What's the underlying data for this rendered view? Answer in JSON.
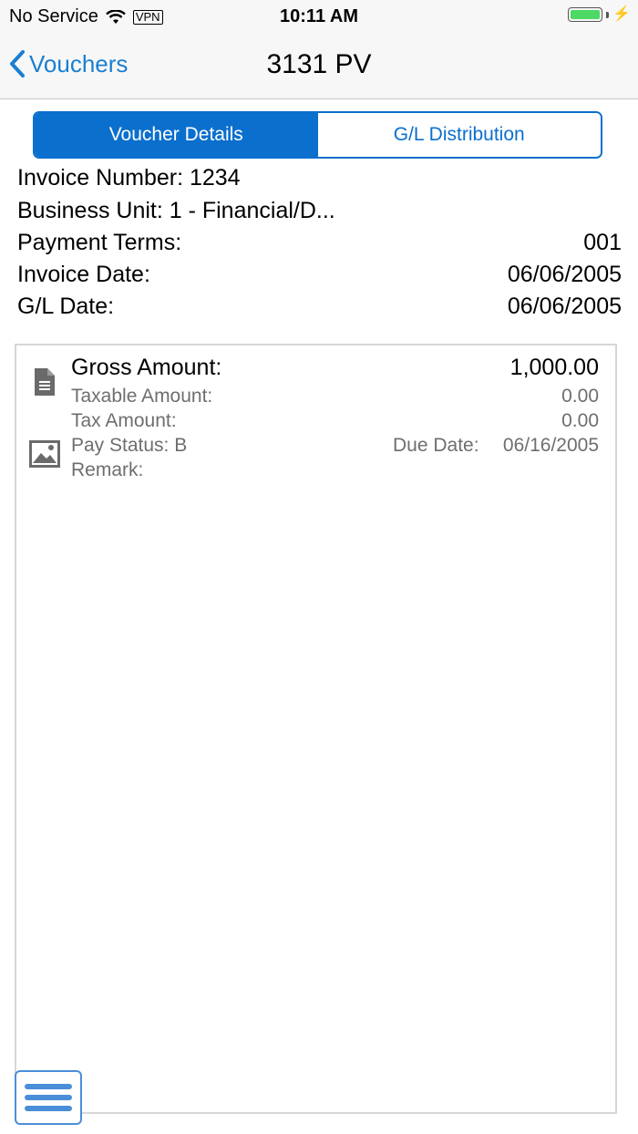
{
  "status_bar": {
    "carrier": "No Service",
    "vpn": "VPN",
    "time": "10:11 AM",
    "battery_level": 1.0
  },
  "nav": {
    "back_label": "Vouchers",
    "title": "3131 PV"
  },
  "tabs": [
    {
      "label": "Voucher Details",
      "active": true
    },
    {
      "label": "G/L Distribution",
      "active": false
    }
  ],
  "header_fields": {
    "invoice_number": "Invoice Number: 1234",
    "business_unit": "Business Unit: 1 - Financial/D...",
    "payment_terms_label": "Payment Terms:",
    "payment_terms_value": "001",
    "invoice_date_label": "Invoice Date:",
    "invoice_date_value": "06/06/2005",
    "gl_date_label": "G/L Date:",
    "gl_date_value": "06/06/2005"
  },
  "detail_card": {
    "gross_amount_label": "Gross Amount:",
    "gross_amount_value": "1,000.00",
    "taxable_amount_label": "Taxable Amount:",
    "taxable_amount_value": "0.00",
    "tax_amount_label": "Tax Amount:",
    "tax_amount_value": "0.00",
    "pay_status": "Pay Status: B",
    "due_date_label": "Due Date:",
    "due_date_value": "06/16/2005",
    "remark_label": "Remark:"
  },
  "icons": {
    "document": "document-icon",
    "image": "image-icon",
    "menu": "hamburger-menu-icon"
  },
  "colors": {
    "accent": "#0b6fcd",
    "link": "#1a7fd1",
    "battery": "#4cd964"
  }
}
